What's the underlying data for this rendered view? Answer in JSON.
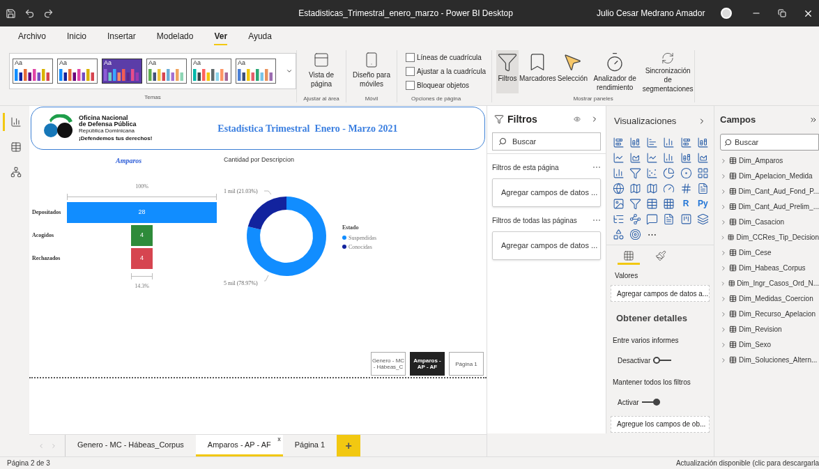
{
  "window": {
    "title": "Estadisticas_Trimestral_enero_marzo - Power BI Desktop",
    "user": "Julio Cesar Medrano Amador"
  },
  "menu": [
    {
      "label": "Archivo",
      "selected": false
    },
    {
      "label": "Inicio",
      "selected": false
    },
    {
      "label": "Insertar",
      "selected": false
    },
    {
      "label": "Modelado",
      "selected": false
    },
    {
      "label": "Ver",
      "selected": true
    },
    {
      "label": "Ayuda",
      "selected": false
    }
  ],
  "ribbon": {
    "themes": [
      {
        "label": "Aa",
        "selected": false
      },
      {
        "label": "Aa",
        "selected": false
      },
      {
        "label": "Aa",
        "selected": true
      },
      {
        "label": "Aa",
        "selected": false
      },
      {
        "label": "Aa",
        "selected": false
      },
      {
        "label": "Aa",
        "selected": false
      }
    ],
    "themes_group": "Temas",
    "page_view": {
      "label": "Vista de página",
      "group": "Ajustar al área"
    },
    "mobile": {
      "label": "Diseño para móviles",
      "group": "Móvil"
    },
    "page_options": [
      {
        "label": "Líneas de cuadrícula",
        "checked": false
      },
      {
        "label": "Ajustar a la cuadrícula",
        "checked": false
      },
      {
        "label": "Bloquear objetos",
        "checked": false
      }
    ],
    "page_options_group": "Opciones de página",
    "panes": [
      {
        "label": "Filtros",
        "kind": "filter",
        "selected": true
      },
      {
        "label": "Marcadores",
        "kind": "bookmark",
        "selected": false
      },
      {
        "label": "Selección",
        "kind": "selection",
        "selected": false
      },
      {
        "label": "Analizador de rendimiento",
        "kind": "performance",
        "selected": false
      },
      {
        "label": "Sincronización de segmentaciones",
        "kind": "sync",
        "selected": false
      }
    ],
    "panes_group": "Mostrar paneles"
  },
  "left_nav": [
    {
      "kind": "report",
      "selected": true
    },
    {
      "kind": "data",
      "selected": false
    },
    {
      "kind": "model",
      "selected": false
    }
  ],
  "report": {
    "logo_lines": [
      "Oficina Nacional",
      "de Defensa Pública",
      "República Dominicana",
      "¡Defendemos tus derechos!"
    ],
    "title": "Estadística Trimestral  Enero - Marzo 2021",
    "funnel": {
      "title": "Amparos",
      "top_label": "100%",
      "bottom_label": "14.3%",
      "stages": [
        {
          "label": "Depositados",
          "value": "28"
        },
        {
          "label": "Acogidos",
          "value": "4"
        },
        {
          "label": "Rechazados",
          "value": "4"
        }
      ]
    },
    "donut": {
      "title": "Cantidad por Descripcion",
      "chart_data": {
        "type": "donut",
        "title": "Estado",
        "categories": [
          "Suspendidas",
          "Conocidas"
        ],
        "values": [
          78.97,
          21.03
        ],
        "legend": "right",
        "value_labels": [
          "5 mil (78.97%)",
          "1 mil (21.03%)"
        ]
      }
    },
    "page_buttons": [
      {
        "label": "Genero - MC - Hábeas_C",
        "selected": false
      },
      {
        "label": "Amparos - AP - AF",
        "selected": true
      },
      {
        "label": "Página 1",
        "selected": false
      }
    ]
  },
  "page_tabs": [
    {
      "label": "Genero - MC - Hábeas_Corpus",
      "selected": false
    },
    {
      "label": "Amparos - AP - AF",
      "selected": true,
      "close": "x"
    },
    {
      "label": "Página 1",
      "selected": false
    }
  ],
  "add_page": "+",
  "filters": {
    "title": "Filtros",
    "search": {
      "placeholder": "Buscar"
    },
    "sections": [
      {
        "title": "Filtros de esta página",
        "more": "⋯",
        "well": "Agregar campos de datos ..."
      },
      {
        "title": "Filtros de todas las páginas",
        "more": "⋯",
        "well": "Agregar campos de datos ..."
      }
    ]
  },
  "visualizations": {
    "title": "Visualizaciones",
    "text_icons": [
      "R",
      "Py"
    ],
    "more": "⋯",
    "tabs": [
      {
        "kind": "fields",
        "selected": true
      },
      {
        "kind": "format",
        "selected": false
      }
    ],
    "values_label": "Valores",
    "values_well": "Agregar campos de datos a...",
    "drill_title": "Obtener detalles",
    "cross_report": "Entre varios informes",
    "toggles": [
      {
        "label": "Desactivar",
        "on": false
      },
      {
        "label": "Activar",
        "on": true
      }
    ],
    "keep_filters": "Mantener todos los filtros",
    "drill_well": "Agregue los campos de ob..."
  },
  "fields": {
    "title": "Campos",
    "search": {
      "placeholder": "Buscar"
    },
    "tables": [
      {
        "name": "Dim_Amparos",
        "expanded": false
      },
      {
        "name": "Dim_Apelacion_Medida",
        "expanded": false
      },
      {
        "name": "Dim_Cant_Aud_Fond_P...",
        "expanded": false
      },
      {
        "name": "Dim_Cant_Aud_Prelim_...",
        "expanded": false
      },
      {
        "name": "Dim_Casacion",
        "expanded": false
      },
      {
        "name": "Dim_CCRes_Tip_Decision",
        "expanded": false
      },
      {
        "name": "Dim_Cese",
        "expanded": false
      },
      {
        "name": "Dim_Habeas_Corpus",
        "expanded": false
      },
      {
        "name": "Dim_Ingr_Casos_Ord_N...",
        "expanded": false
      },
      {
        "name": "Dim_Medidas_Coercion",
        "expanded": false
      },
      {
        "name": "Dim_Recurso_Apelacion",
        "expanded": false
      },
      {
        "name": "Dim_Revision",
        "expanded": false
      },
      {
        "name": "Dim_Sexo",
        "expanded": false
      },
      {
        "name": "Dim_Soluciones_Altern...",
        "expanded": false
      }
    ]
  },
  "status_bar": {
    "page": "Página 2 de 3",
    "update": "Actualización disponible (clic para descargarla"
  }
}
